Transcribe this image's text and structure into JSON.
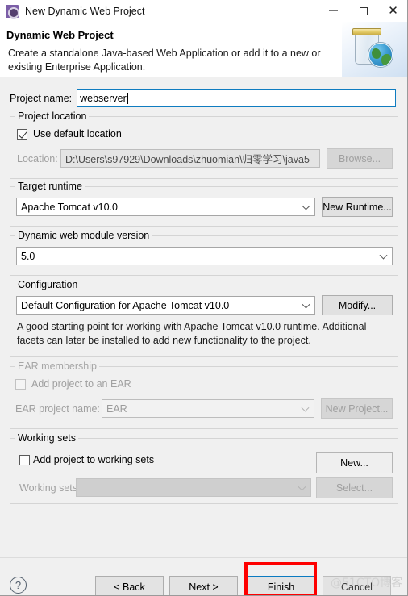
{
  "window": {
    "title": "New Dynamic Web Project",
    "icon": "eclipse-wizard-icon",
    "minimize_label": "",
    "maximize_label": "",
    "close_label": "✕"
  },
  "header": {
    "title": "Dynamic Web Project",
    "description": "Create a standalone Java-based Web Application or add it to a new or existing Enterprise Application.",
    "art_icon": "jar-with-globe-icon"
  },
  "project_name": {
    "label": "Project name:",
    "value": "webserver",
    "placeholder": ""
  },
  "project_location": {
    "group_title": "Project location",
    "use_default_label": "Use default location",
    "use_default_checked": true,
    "location_label": "Location:",
    "location_value": "D:\\Users\\s97929\\Downloads\\zhuomian\\归零学习\\java5",
    "browse_label": "Browse..."
  },
  "target_runtime": {
    "group_title": "Target runtime",
    "value": "Apache Tomcat v10.0",
    "new_runtime_label": "New Runtime..."
  },
  "web_module": {
    "group_title": "Dynamic web module version",
    "value": "5.0"
  },
  "configuration": {
    "group_title": "Configuration",
    "value": "Default Configuration for Apache Tomcat v10.0",
    "modify_label": "Modify...",
    "description": "A good starting point for working with Apache Tomcat v10.0 runtime. Additional facets can later be installed to add new functionality to the project."
  },
  "ear_membership": {
    "group_title": "EAR membership",
    "add_to_ear_label": "Add project to an EAR",
    "add_to_ear_checked": false,
    "ear_project_name_label": "EAR project name:",
    "ear_project_name_value": "EAR",
    "new_project_label": "New Project..."
  },
  "working_sets": {
    "group_title": "Working sets",
    "add_to_working_sets_label": "Add project to working sets",
    "add_to_working_sets_checked": false,
    "working_sets_label": "Working sets:",
    "working_sets_value": "",
    "new_label": "New...",
    "select_label": "Select..."
  },
  "footer": {
    "help_icon": "question-mark-icon",
    "help_glyph": "?",
    "back_label": "< Back",
    "next_label": "Next >",
    "finish_label": "Finish",
    "cancel_label": "Cancel"
  },
  "annotation": {
    "highlight_color": "#fe0000",
    "focus_color": "#0b7bc1",
    "watermark": "@51CTO博客"
  }
}
